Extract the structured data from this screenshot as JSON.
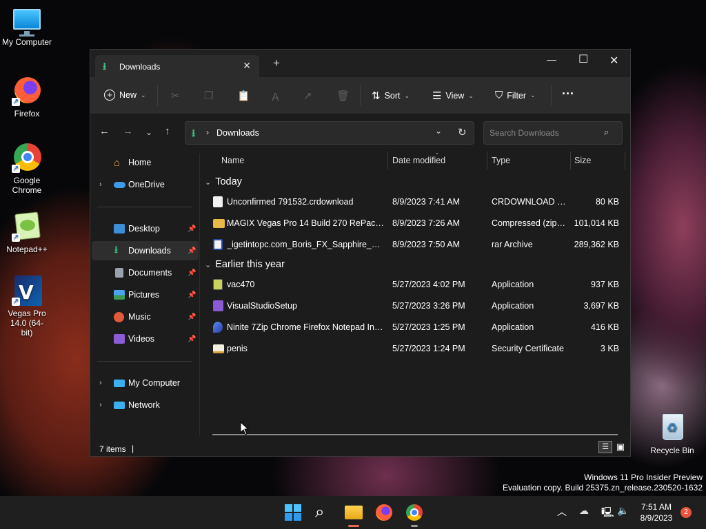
{
  "desktop": {
    "icons": [
      {
        "label": "My Computer",
        "icon": "monitor-icon"
      },
      {
        "label": "Firefox",
        "icon": "firefox-icon"
      },
      {
        "label": "Google Chrome",
        "icon": "chrome-icon"
      },
      {
        "label": "Notepad++",
        "icon": "notepad-plus-plus-icon"
      },
      {
        "label": "Vegas Pro 14.0 (64-bit)",
        "icon": "vegas-pro-icon"
      },
      {
        "label": "Recycle Bin",
        "icon": "recycle-bin-icon"
      }
    ],
    "watermark_line1": "Windows 11 Pro Insider Preview",
    "watermark_line2": "Evaluation copy. Build 25375.zn_release.230520-1632"
  },
  "window": {
    "tab_title": "Downloads",
    "toolbar": {
      "new_label": "New",
      "sort_label": "Sort",
      "view_label": "View",
      "filter_label": "Filter",
      "more_label": "···"
    },
    "address": {
      "path": "Downloads"
    },
    "search": {
      "placeholder": "Search Downloads"
    },
    "sidebar": {
      "home": "Home",
      "onedrive": "OneDrive",
      "desktop": "Desktop",
      "downloads": "Downloads",
      "documents": "Documents",
      "pictures": "Pictures",
      "music": "Music",
      "videos": "Videos",
      "my_computer": "My Computer",
      "network": "Network"
    },
    "columns": {
      "name": "Name",
      "date": "Date modified",
      "type": "Type",
      "size": "Size"
    },
    "groups": {
      "today": {
        "label": "Today",
        "files": [
          {
            "name": "Unconfirmed 791532.crdownload",
            "date": "8/9/2023 7:41 AM",
            "type": "CRDOWNLOAD File",
            "size": "80 KB",
            "icon": "blank-file-icon"
          },
          {
            "name": "MAGIX Vegas Pro 14 Build 270 RePack by ...",
            "date": "8/9/2023 7:26 AM",
            "type": "Compressed (zipp...",
            "size": "101,014 KB",
            "icon": "zip-folder-icon"
          },
          {
            "name": "_igetintopc.com_Boris_FX_Sapphire_Plug...",
            "date": "8/9/2023 7:50 AM",
            "type": "rar Archive",
            "size": "289,362 KB",
            "icon": "rar-archive-icon"
          }
        ]
      },
      "earlier": {
        "label": "Earlier this year",
        "files": [
          {
            "name": "vac470",
            "date": "5/27/2023 4:02 PM",
            "type": "Application",
            "size": "937 KB",
            "icon": "app-icon"
          },
          {
            "name": "VisualStudioSetup",
            "date": "5/27/2023 3:26 PM",
            "type": "Application",
            "size": "3,697 KB",
            "icon": "visual-studio-icon"
          },
          {
            "name": "Ninite 7Zip Chrome Firefox Notepad Inst...",
            "date": "5/27/2023 1:25 PM",
            "type": "Application",
            "size": "416 KB",
            "icon": "ninite-icon"
          },
          {
            "name": "penis",
            "date": "5/27/2023 1:24 PM",
            "type": "Security Certificate",
            "size": "3 KB",
            "icon": "certificate-icon"
          }
        ]
      }
    },
    "status": {
      "count": "7 items",
      "sep": "|"
    }
  },
  "taskbar": {
    "time": "7:51 AM",
    "date": "8/9/2023",
    "notification_count": "2"
  },
  "colors": {
    "accent": "#0078d4",
    "download_green": "#3dbd7d"
  }
}
